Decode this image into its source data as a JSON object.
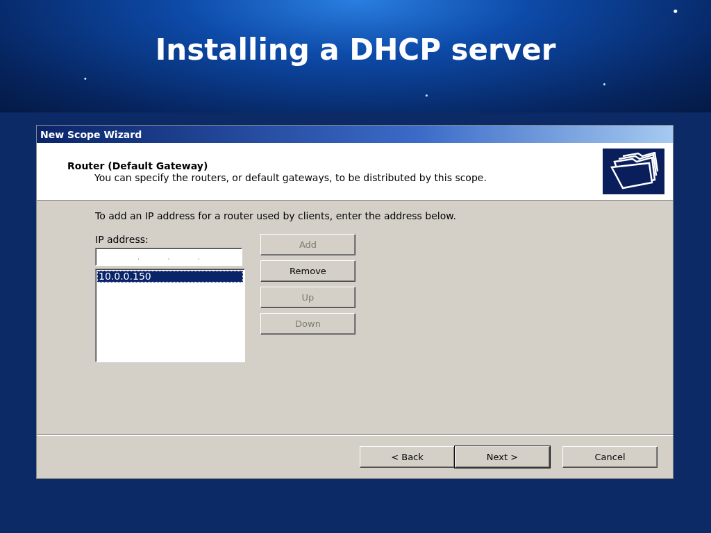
{
  "slide": {
    "title": "Installing a DHCP server"
  },
  "window": {
    "title": "New Scope Wizard"
  },
  "header": {
    "title": "Router (Default Gateway)",
    "subtitle": "You can specify the routers, or default gateways, to be distributed by this scope."
  },
  "instruction": "To add an IP address for a router used by clients, enter the address below.",
  "ip_field": {
    "label": "IP address:",
    "separators": [
      ".",
      ".",
      "."
    ]
  },
  "router_list": [
    {
      "label": "10.0.0.150",
      "selected": true
    }
  ],
  "side_buttons": [
    {
      "label": "Add",
      "disabled": true
    },
    {
      "label": "Remove",
      "disabled": false
    },
    {
      "label": "Up",
      "disabled": true
    },
    {
      "label": "Down",
      "disabled": true
    }
  ],
  "footer_buttons": [
    {
      "label": "< Back",
      "default": false
    },
    {
      "label": "Next >",
      "default": true
    },
    {
      "label": "Cancel",
      "default": false
    }
  ]
}
